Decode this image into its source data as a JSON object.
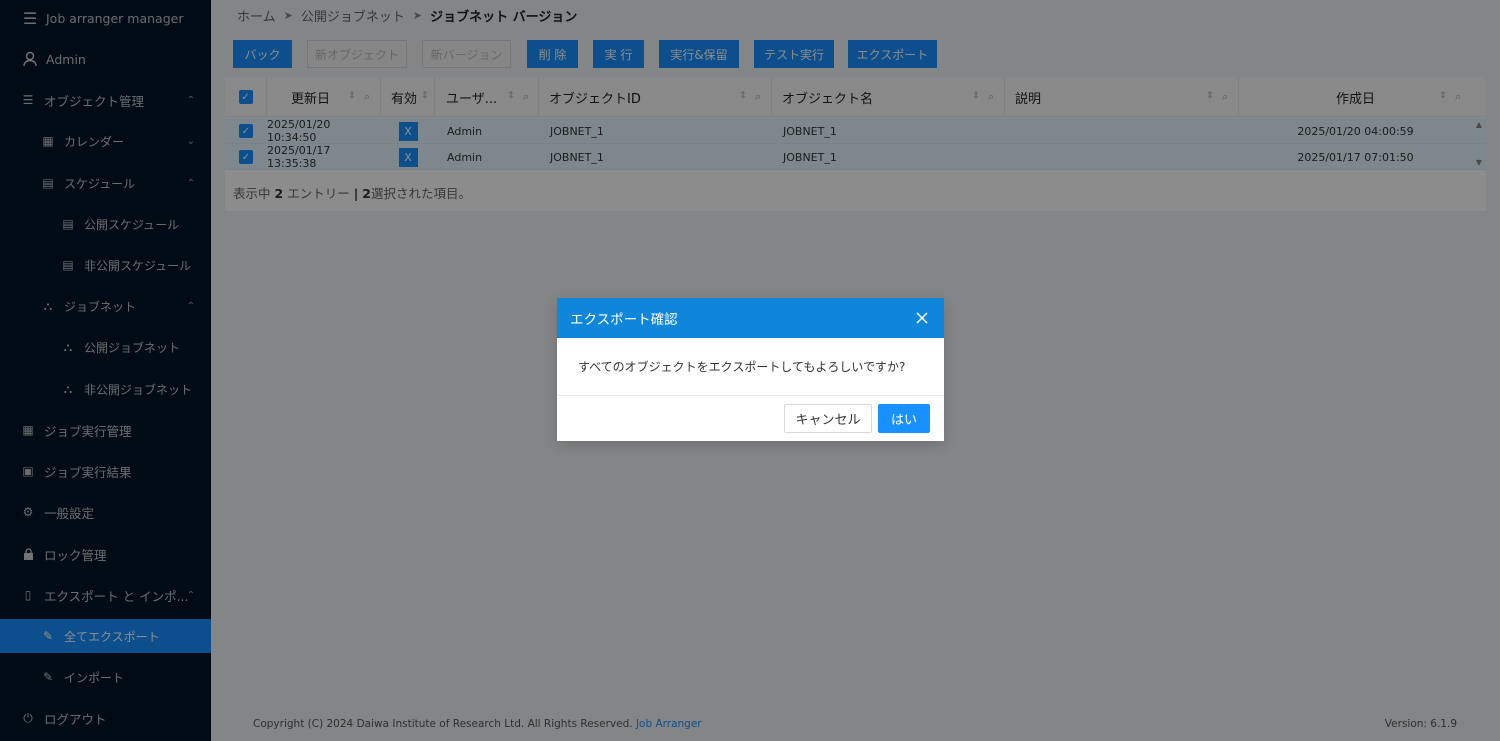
{
  "app": {
    "title": "Job arranger manager",
    "user": "Admin"
  },
  "sidebar": {
    "items": [
      {
        "label": "オブジェクト管理",
        "icon": "list-icon",
        "chevron": "up"
      },
      {
        "label": "カレンダー",
        "icon": "calendar-icon",
        "chevron": "down"
      },
      {
        "label": "スケジュール",
        "icon": "schedule-icon",
        "chevron": "up"
      },
      {
        "label": "公開スケジュール",
        "icon": "schedule-icon"
      },
      {
        "label": "非公開スケジュール",
        "icon": "schedule-icon"
      },
      {
        "label": "ジョブネット",
        "icon": "network-icon",
        "chevron": "up"
      },
      {
        "label": "公開ジョブネット",
        "icon": "network-icon"
      },
      {
        "label": "非公開ジョブネット",
        "icon": "network-icon"
      },
      {
        "label": "ジョブ実行管理",
        "icon": "table-icon"
      },
      {
        "label": "ジョブ実行結果",
        "icon": "board-icon"
      },
      {
        "label": "一般設定",
        "icon": "gear-icon"
      },
      {
        "label": "ロック管理",
        "icon": "lock-icon"
      },
      {
        "label": "エクスポート と インポ...",
        "icon": "file-icon",
        "chevron": "up"
      },
      {
        "label": "全てエクスポート",
        "icon": "edit-icon",
        "active": true
      },
      {
        "label": "インポート",
        "icon": "edit-icon"
      },
      {
        "label": "ログアウト",
        "icon": "logout-icon"
      }
    ]
  },
  "breadcrumb": {
    "home": "ホーム",
    "mid": "公開ジョブネット",
    "current": "ジョブネット バージョン"
  },
  "toolbar": {
    "back": "バック",
    "new_object": "新オブジェクト",
    "new_version": "新バージョン",
    "delete": "削 除",
    "run": "実 行",
    "run_hold": "実行&保留",
    "test_run": "テスト実行",
    "export": "エクスポート"
  },
  "grid": {
    "columns": [
      "更新日",
      "有効",
      "ユーザ...",
      "オブジェクトID",
      "オブジェクト名",
      "説明",
      "作成日"
    ],
    "rows": [
      {
        "updated": "2025/01/20 10:34:50",
        "valid": "X",
        "user": "Admin",
        "object_id": "JOBNET_1",
        "object_name": "JOBNET_1",
        "description": "",
        "created": "2025/01/20 04:00:59"
      },
      {
        "updated": "2025/01/17 13:35:38",
        "valid": "X",
        "user": "Admin",
        "object_id": "JOBNET_1",
        "object_name": "JOBNET_1",
        "description": "",
        "created": "2025/01/17 07:01:50"
      }
    ],
    "footer": {
      "showing": "表示中",
      "count": "2",
      "entries": "エントリー",
      "sep": "|",
      "selected_count": "2",
      "selected": "選択された項目。"
    }
  },
  "footer": {
    "copyright": "Copyright (C) 2024 Daiwa Institute of Research Ltd. All Rights Reserved.",
    "link": "Job Arranger",
    "version": "Version: 6.1.9"
  },
  "modal": {
    "title": "エクスポート確認",
    "message": "すべてのオブジェクトをエクスポートしてもよろしいですか?",
    "cancel": "キャンセル",
    "ok": "はい"
  },
  "colors": {
    "sidebar_bg": "#001529",
    "accent": "#1890ff",
    "modal_header": "#0f86d9"
  }
}
